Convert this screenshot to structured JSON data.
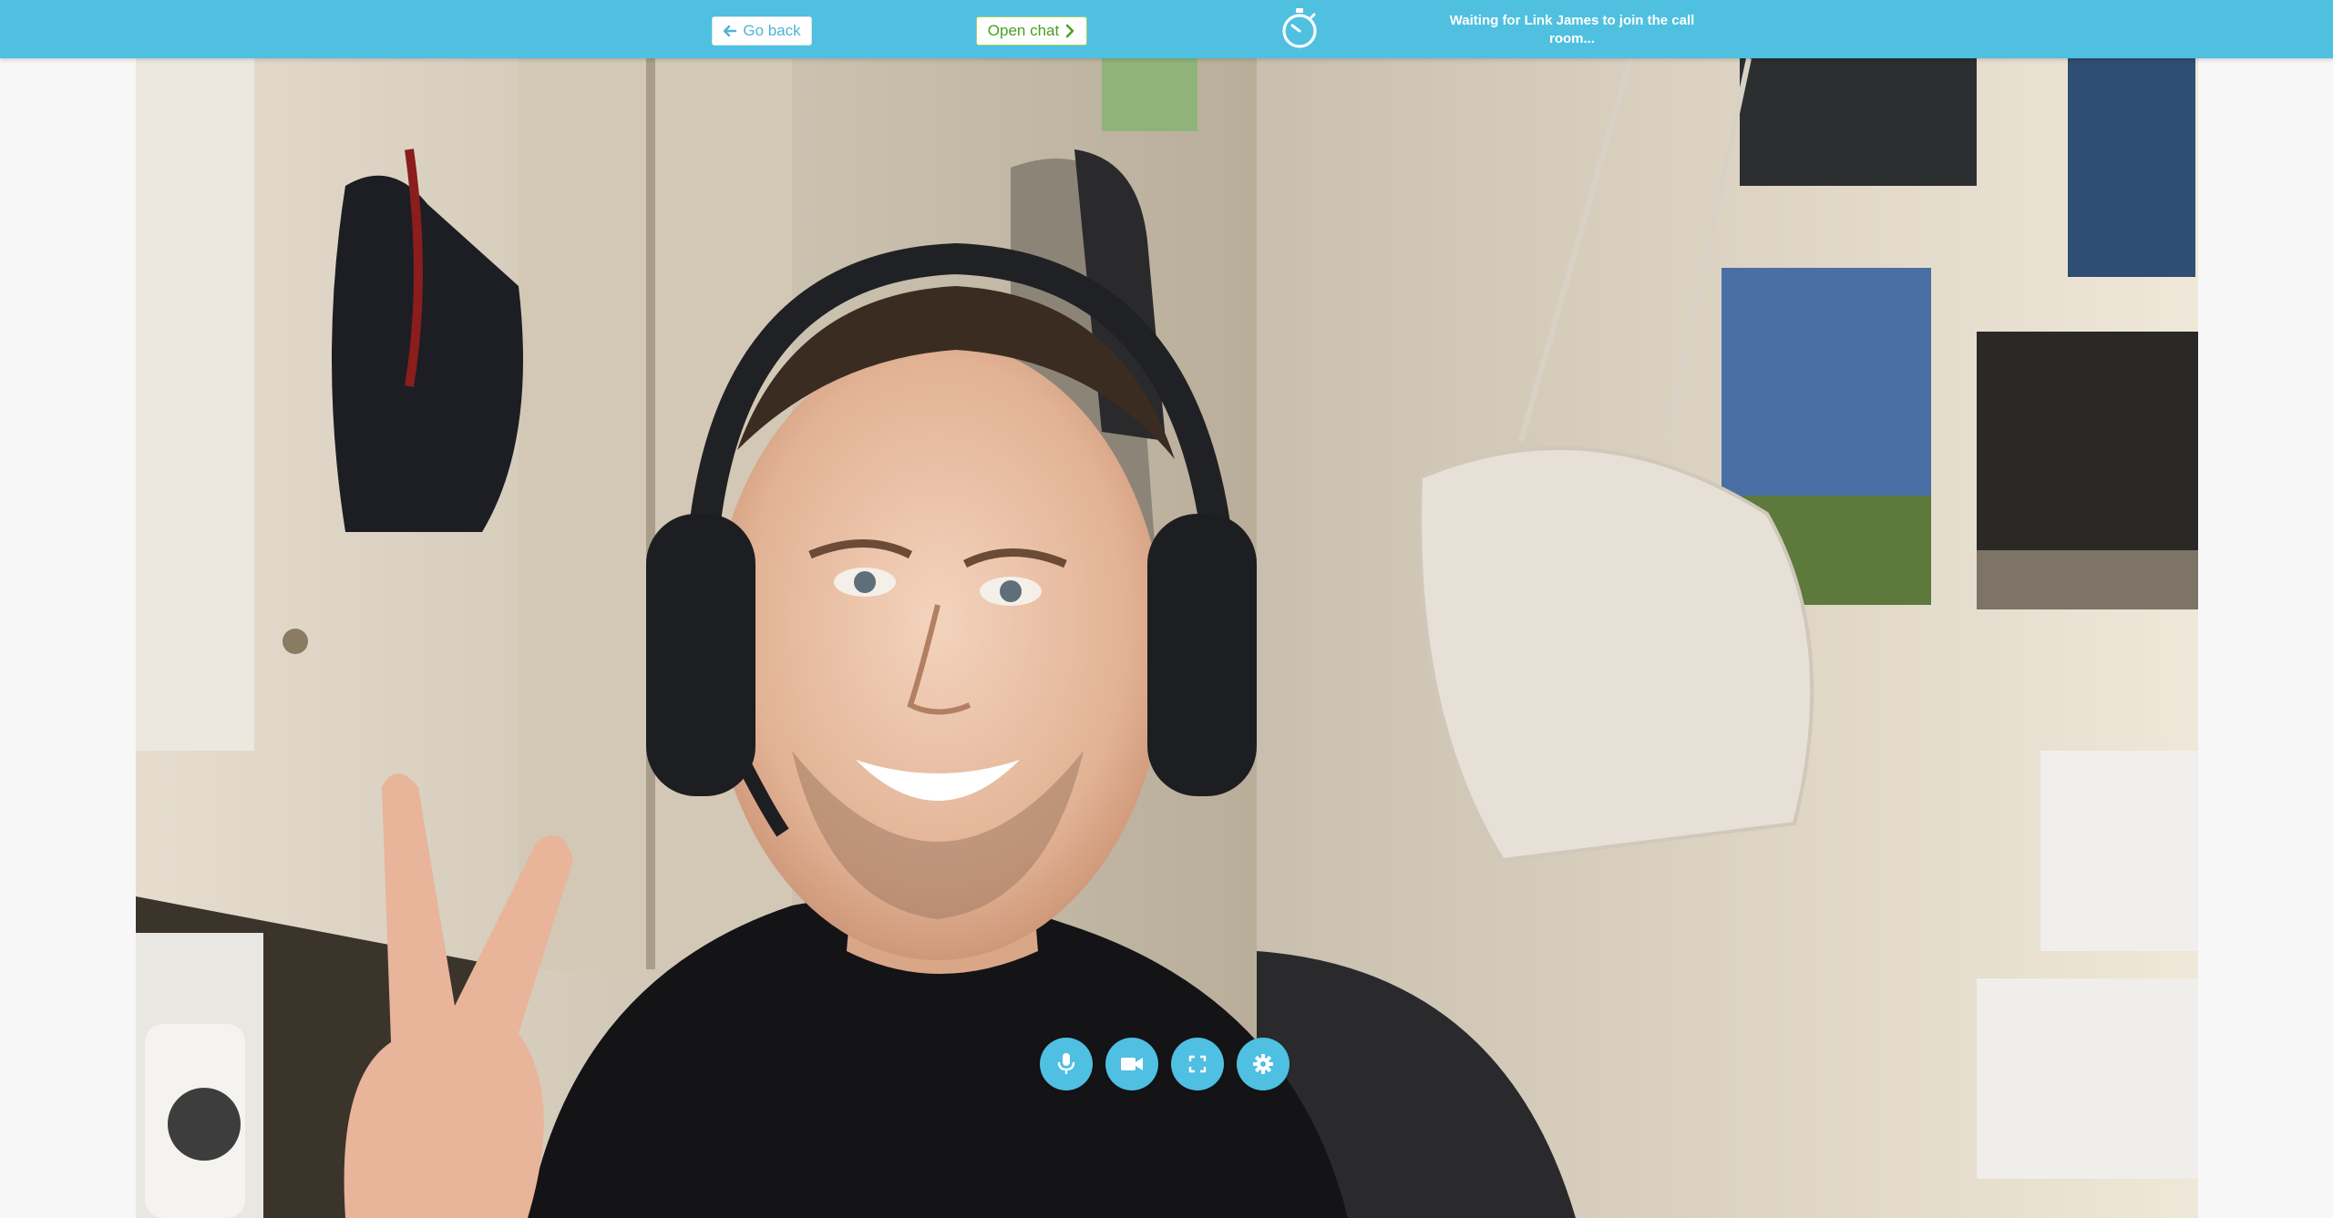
{
  "header": {
    "back_label": "Go back",
    "open_chat_label": "Open chat",
    "status_text": "Waiting for Link James to join the call room...",
    "background_color": "#4fc0e0"
  },
  "icons": {
    "back": "arrow-left-icon",
    "chat": "chevron-right-icon",
    "timer": "stopwatch-icon",
    "mic": "microphone-icon",
    "camera": "video-camera-icon",
    "fullscreen": "fullscreen-icon",
    "settings": "gear-icon"
  },
  "controls": [
    {
      "name": "mute-microphone-button",
      "icon": "microphone-icon"
    },
    {
      "name": "toggle-camera-button",
      "icon": "video-camera-icon"
    },
    {
      "name": "fullscreen-button",
      "icon": "fullscreen-icon"
    },
    {
      "name": "settings-button",
      "icon": "gear-icon"
    }
  ],
  "video": {
    "content": "self-view webcam feed"
  }
}
